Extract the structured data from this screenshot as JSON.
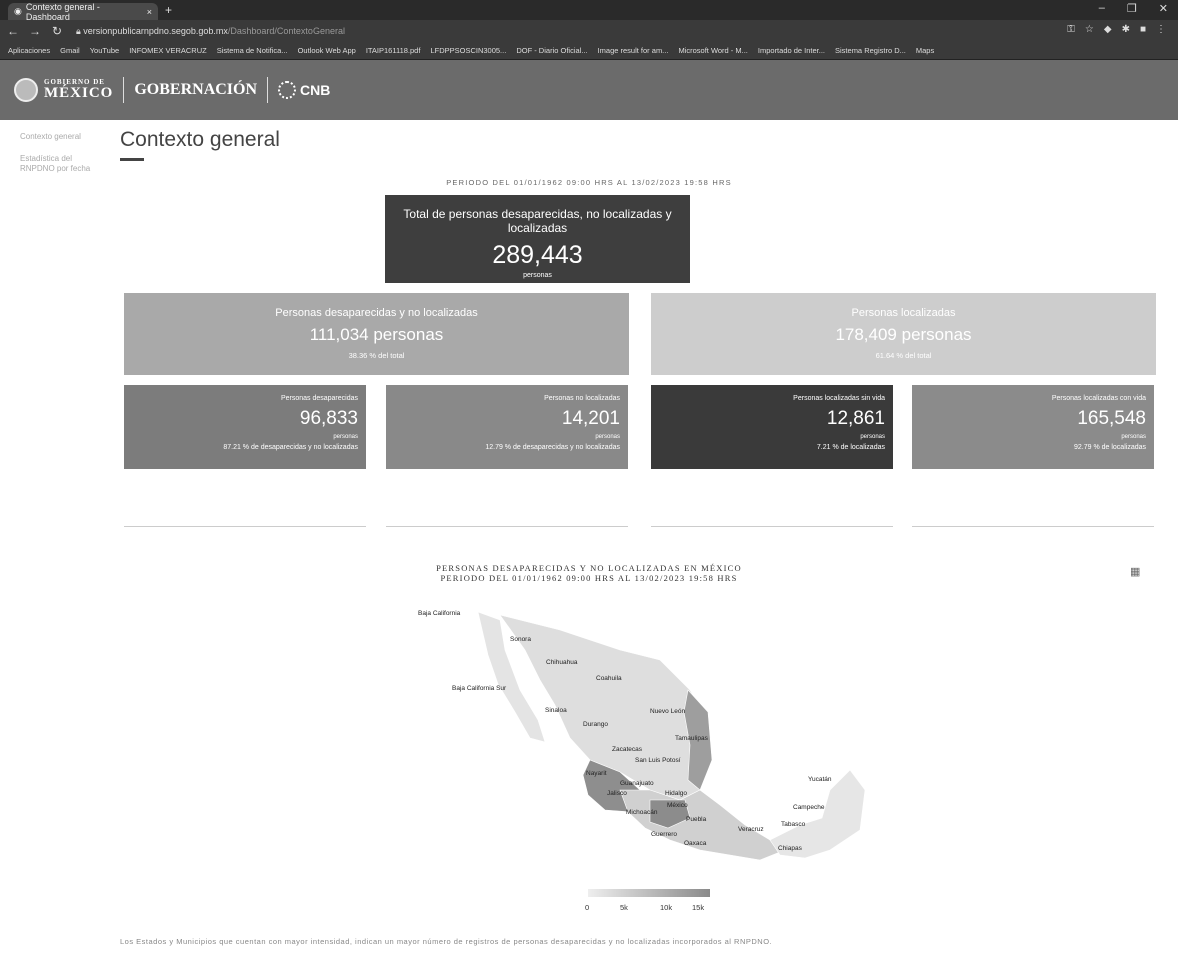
{
  "browser": {
    "tab_title": "Contexto general - Dashboard",
    "tab_close": "×",
    "new_tab": "+",
    "url": "versionpublicarnpdno.segob.gob.mx",
    "url_path": "/Dashboard/ContextoGeneral",
    "bookmarks": [
      "Aplicaciones",
      "Gmail",
      "YouTube",
      "INFOMEX VERACRUZ",
      "Sistema de Notifica...",
      "Outlook Web App",
      "ITAIP161118.pdf",
      "LFDPPSOSCIN3005...",
      "DOF - Diario Oficial...",
      "Image result for am...",
      "Microsoft Word - M...",
      "Importado de Inter...",
      "Sistema Registro D...",
      "Maps"
    ]
  },
  "header": {
    "gov_small": "GOBIERNO DE",
    "gov_big": "MÉXICO",
    "gobernacion": "GOBERNACIÓN",
    "cnb": "CNB"
  },
  "sidenav": [
    "Contexto general",
    "Estadística del RNPDNO por fecha"
  ],
  "page": {
    "title": "Contexto general",
    "period": "PERIODO DEL 01/01/1962 09:00 HRS AL 13/02/2023 19:58 HRS"
  },
  "total": {
    "title": "Total de personas desaparecidas, no localizadas y localizadas",
    "value": "289,443",
    "unit": "personas"
  },
  "desaparecidas_nolocalizadas": {
    "title": "Personas desaparecidas y no localizadas",
    "value": "111,034 personas",
    "pct": "38.36 % del total"
  },
  "localizadas": {
    "title": "Personas localizadas",
    "value": "178,409 personas",
    "pct": "61.64 % del total"
  },
  "small_cards": [
    {
      "title": "Personas desaparecidas",
      "value": "96,833",
      "unit": "personas",
      "pct": "87.21 % de desaparecidas y no localizadas"
    },
    {
      "title": "Personas no localizadas",
      "value": "14,201",
      "unit": "personas",
      "pct": "12.79 % de desaparecidas y no localizadas"
    },
    {
      "title": "Personas localizadas sin vida",
      "value": "12,861",
      "unit": "personas",
      "pct": "7.21 % de localizadas"
    },
    {
      "title": "Personas localizadas con vida",
      "value": "165,548",
      "unit": "personas",
      "pct": "92.79 % de localizadas"
    }
  ],
  "map": {
    "title": "PERSONAS DESAPARECIDAS Y NO LOCALIZADAS EN MÉXICO",
    "subtitle": "PERIODO DEL 01/01/1962 09:00 HRS AL 13/02/2023 19:58 HRS",
    "menu_icon": "grid-menu-icon",
    "states": [
      "Baja California",
      "Sonora",
      "Chihuahua",
      "Coahuila",
      "Baja California Sur",
      "Sinaloa",
      "Durango",
      "Nuevo León",
      "Tamaulipas",
      "Zacatecas",
      "San Luis Potosí",
      "Nayarit",
      "Jalisco",
      "Guanajuato",
      "Hidalgo",
      "Michoacán",
      "México",
      "Puebla",
      "Veracruz",
      "Guerrero",
      "Oaxaca",
      "Chiapas",
      "Tabasco",
      "Campeche",
      "Yucatán"
    ],
    "legend": [
      "0",
      "5k",
      "10k",
      "15k"
    ]
  },
  "footnote": "Los Estados y Municipios que cuentan con mayor intensidad, indican un mayor número de registros de personas desaparecidas y no localizadas incorporados al RNPDNO."
}
